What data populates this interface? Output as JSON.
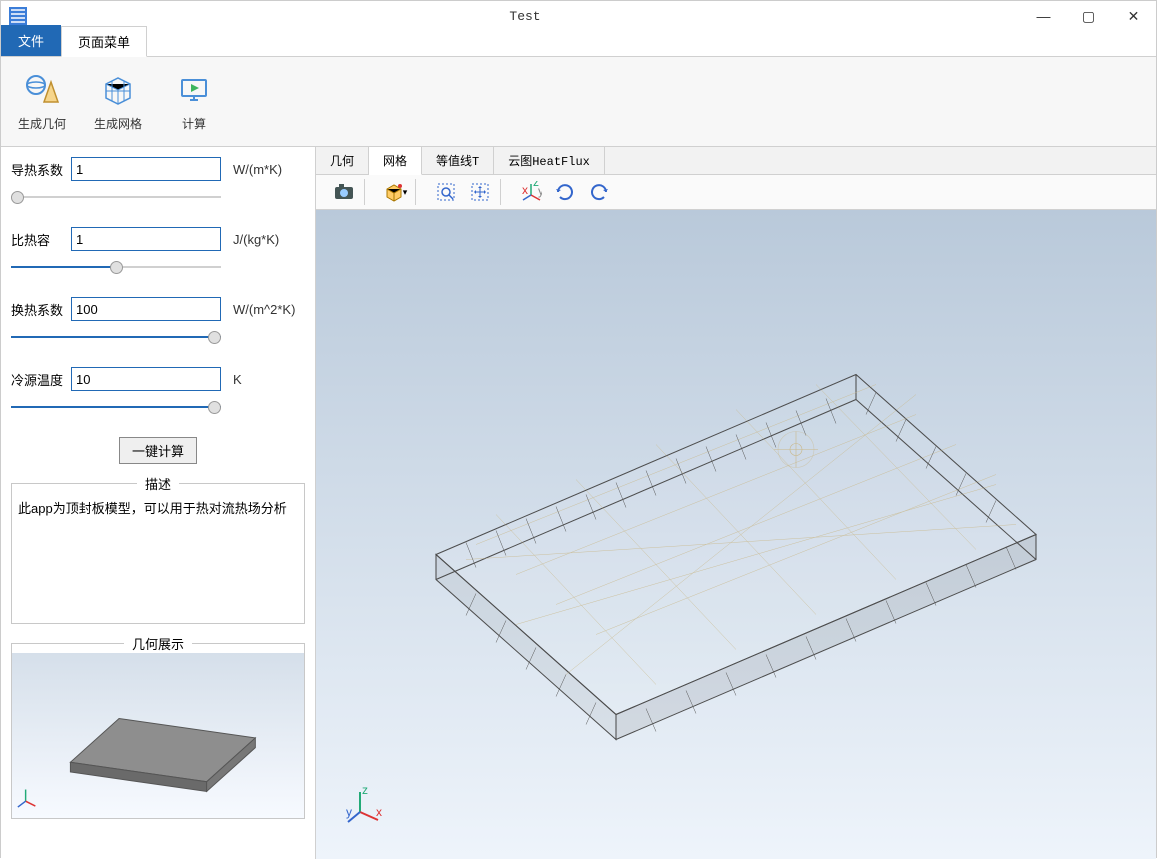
{
  "window": {
    "title": "Test",
    "controls": {
      "minimize": "—",
      "maximize": "▢",
      "close": "✕"
    }
  },
  "ribbon": {
    "tabs": [
      "文件",
      "页面菜单"
    ],
    "active_tab_index": 0,
    "buttons": [
      {
        "id": "gen-geometry",
        "label": "生成几何",
        "icon": "sphere-cone"
      },
      {
        "id": "gen-mesh",
        "label": "生成网格",
        "icon": "cube-mesh"
      },
      {
        "id": "compute",
        "label": "计算",
        "icon": "play-monitor"
      }
    ]
  },
  "parameters": [
    {
      "id": "thermal-conductivity",
      "label": "导热系数",
      "value": "1",
      "unit": "W/(m*K)",
      "slider_pct": 0
    },
    {
      "id": "specific-heat",
      "label": "比热容",
      "value": "1",
      "unit": "J/(kg*K)",
      "slider_pct": 50
    },
    {
      "id": "heat-transfer-coef",
      "label": "换热系数",
      "value": "100",
      "unit": "W/(m^2*K)",
      "slider_pct": 100
    },
    {
      "id": "cold-source-temp",
      "label": "冷源温度",
      "value": "10",
      "unit": "K",
      "slider_pct": 100
    }
  ],
  "compute_button": "一键计算",
  "sections": {
    "description_title": "描述",
    "description_text": "此app为顶封板模型，可以用于热对流热场分析",
    "geometry_title": "几何展示"
  },
  "view": {
    "tabs": [
      "几何",
      "网格",
      "等值线T",
      "云图HeatFlux"
    ],
    "active_tab_index": 1,
    "toolbar_icons": [
      "snapshot",
      "view-cube",
      "select-rect",
      "pan-cross",
      "axis-xyz",
      "rotate-ccw",
      "rotate-cw"
    ]
  }
}
